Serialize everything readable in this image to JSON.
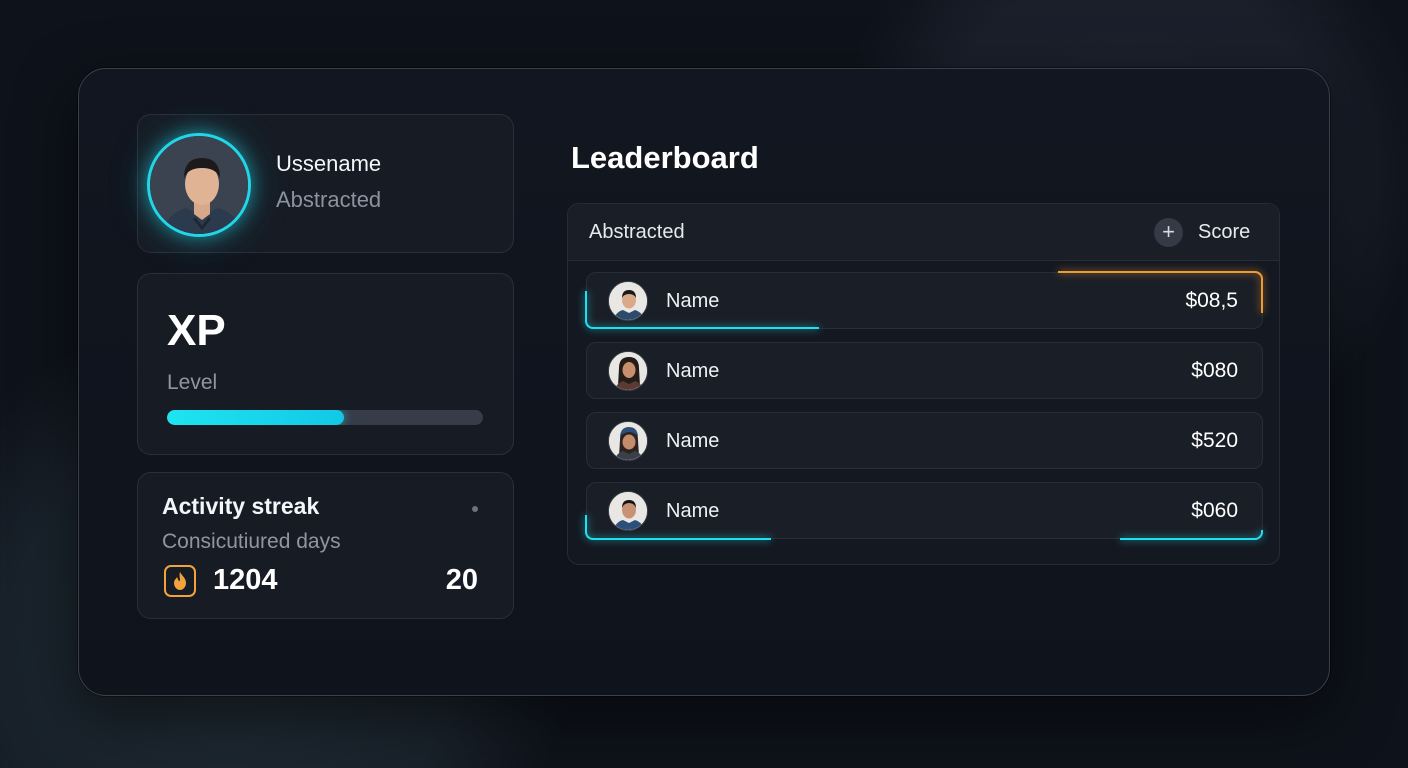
{
  "profile": {
    "username": "Ussename",
    "subtitle": "Abstracted"
  },
  "xp": {
    "title": "XP",
    "level_label": "Level",
    "progress": 0.56
  },
  "streak": {
    "title": "Activity streak",
    "subtitle": "Consicutiured days",
    "count": "1204",
    "days": "20",
    "icon": "flame-icon"
  },
  "leaderboard": {
    "title": "Leaderboard",
    "column_left": "Abstracted",
    "column_right": "Score",
    "add_icon": "plus-icon",
    "rows": [
      {
        "name": "Name",
        "score": "$08,5"
      },
      {
        "name": "Name",
        "score": "$080"
      },
      {
        "name": "Name",
        "score": "$520"
      },
      {
        "name": "Name",
        "score": "$060"
      }
    ]
  },
  "colors": {
    "accent_cyan": "#1fe0ee",
    "accent_orange": "#f29a32",
    "background": "#0e121a"
  }
}
